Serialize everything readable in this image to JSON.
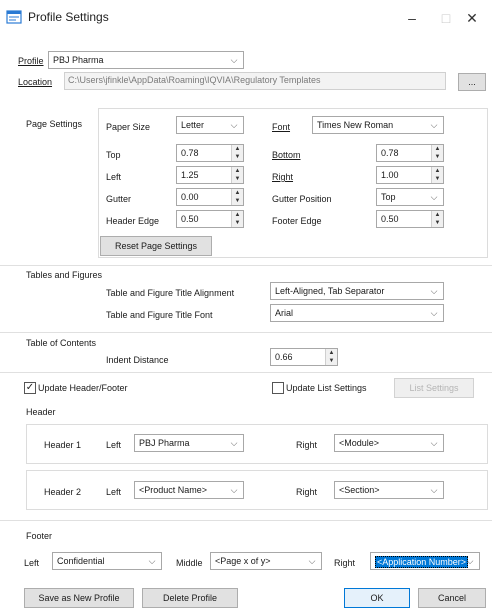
{
  "window": {
    "title": "Profile Settings",
    "minimize": "–",
    "maximize": "□",
    "close": "✕"
  },
  "profile": {
    "label": "Profile",
    "value": "PBJ Pharma",
    "location_label": "Location",
    "location_value": "C:\\Users\\jfinkle\\AppData\\Roaming\\IQVIA\\Regulatory Templates",
    "browse_label": "..."
  },
  "page_settings": {
    "section_label": "Page Settings",
    "paper_size_label": "Paper Size",
    "paper_size_value": "Letter",
    "font_label": "Font",
    "font_value": "Times New Roman",
    "top_label": "Top",
    "top_value": "0.78",
    "bottom_label": "Bottom",
    "bottom_value": "0.78",
    "left_label": "Left",
    "left_value": "1.25",
    "right_label": "Right",
    "right_value": "1.00",
    "gutter_label": "Gutter",
    "gutter_value": "0.00",
    "gutter_position_label": "Gutter Position",
    "gutter_position_value": "Top",
    "header_edge_label": "Header Edge",
    "header_edge_value": "0.50",
    "footer_edge_label": "Footer Edge",
    "footer_edge_value": "0.50",
    "reset_button": "Reset Page Settings"
  },
  "tables_figures": {
    "section_label": "Tables and Figures",
    "alignment_label": "Table and Figure Title Alignment",
    "alignment_value": "Left-Aligned, Tab Separator",
    "font_label": "Table and Figure Title Font",
    "font_value": "Arial"
  },
  "toc": {
    "section_label": "Table of Contents",
    "indent_label": "Indent Distance",
    "indent_value": "0.66"
  },
  "options": {
    "update_header_footer_label": "Update Header/Footer",
    "update_header_footer_checked": true,
    "update_list_settings_label": "Update List Settings",
    "update_list_settings_checked": false,
    "list_settings_button": "List Settings"
  },
  "header": {
    "section_label": "Header",
    "header1_label": "Header 1",
    "header1_left_label": "Left",
    "header1_left_value": "PBJ Pharma",
    "header1_right_label": "Right",
    "header1_right_value": "<Module>",
    "header2_label": "Header 2",
    "header2_left_label": "Left",
    "header2_left_value": "<Product Name>",
    "header2_right_label": "Right",
    "header2_right_value": "<Section>"
  },
  "footer": {
    "section_label": "Footer",
    "left_label": "Left",
    "left_value": "Confidential",
    "middle_label": "Middle",
    "middle_value": "<Page x of y>",
    "right_label": "Right",
    "right_value": "<Application Number>"
  },
  "buttons": {
    "save_as_new": "Save as New Profile",
    "delete": "Delete Profile",
    "ok": "OK",
    "cancel": "Cancel"
  },
  "icons": {
    "app": "profile-settings-icon",
    "dropdown": "chevron-down-icon",
    "spin": "spin-arrows-icon",
    "check": "checkmark-icon"
  },
  "colors": {
    "accent": "#0078d7",
    "app_icon": "#2b7bd4"
  }
}
